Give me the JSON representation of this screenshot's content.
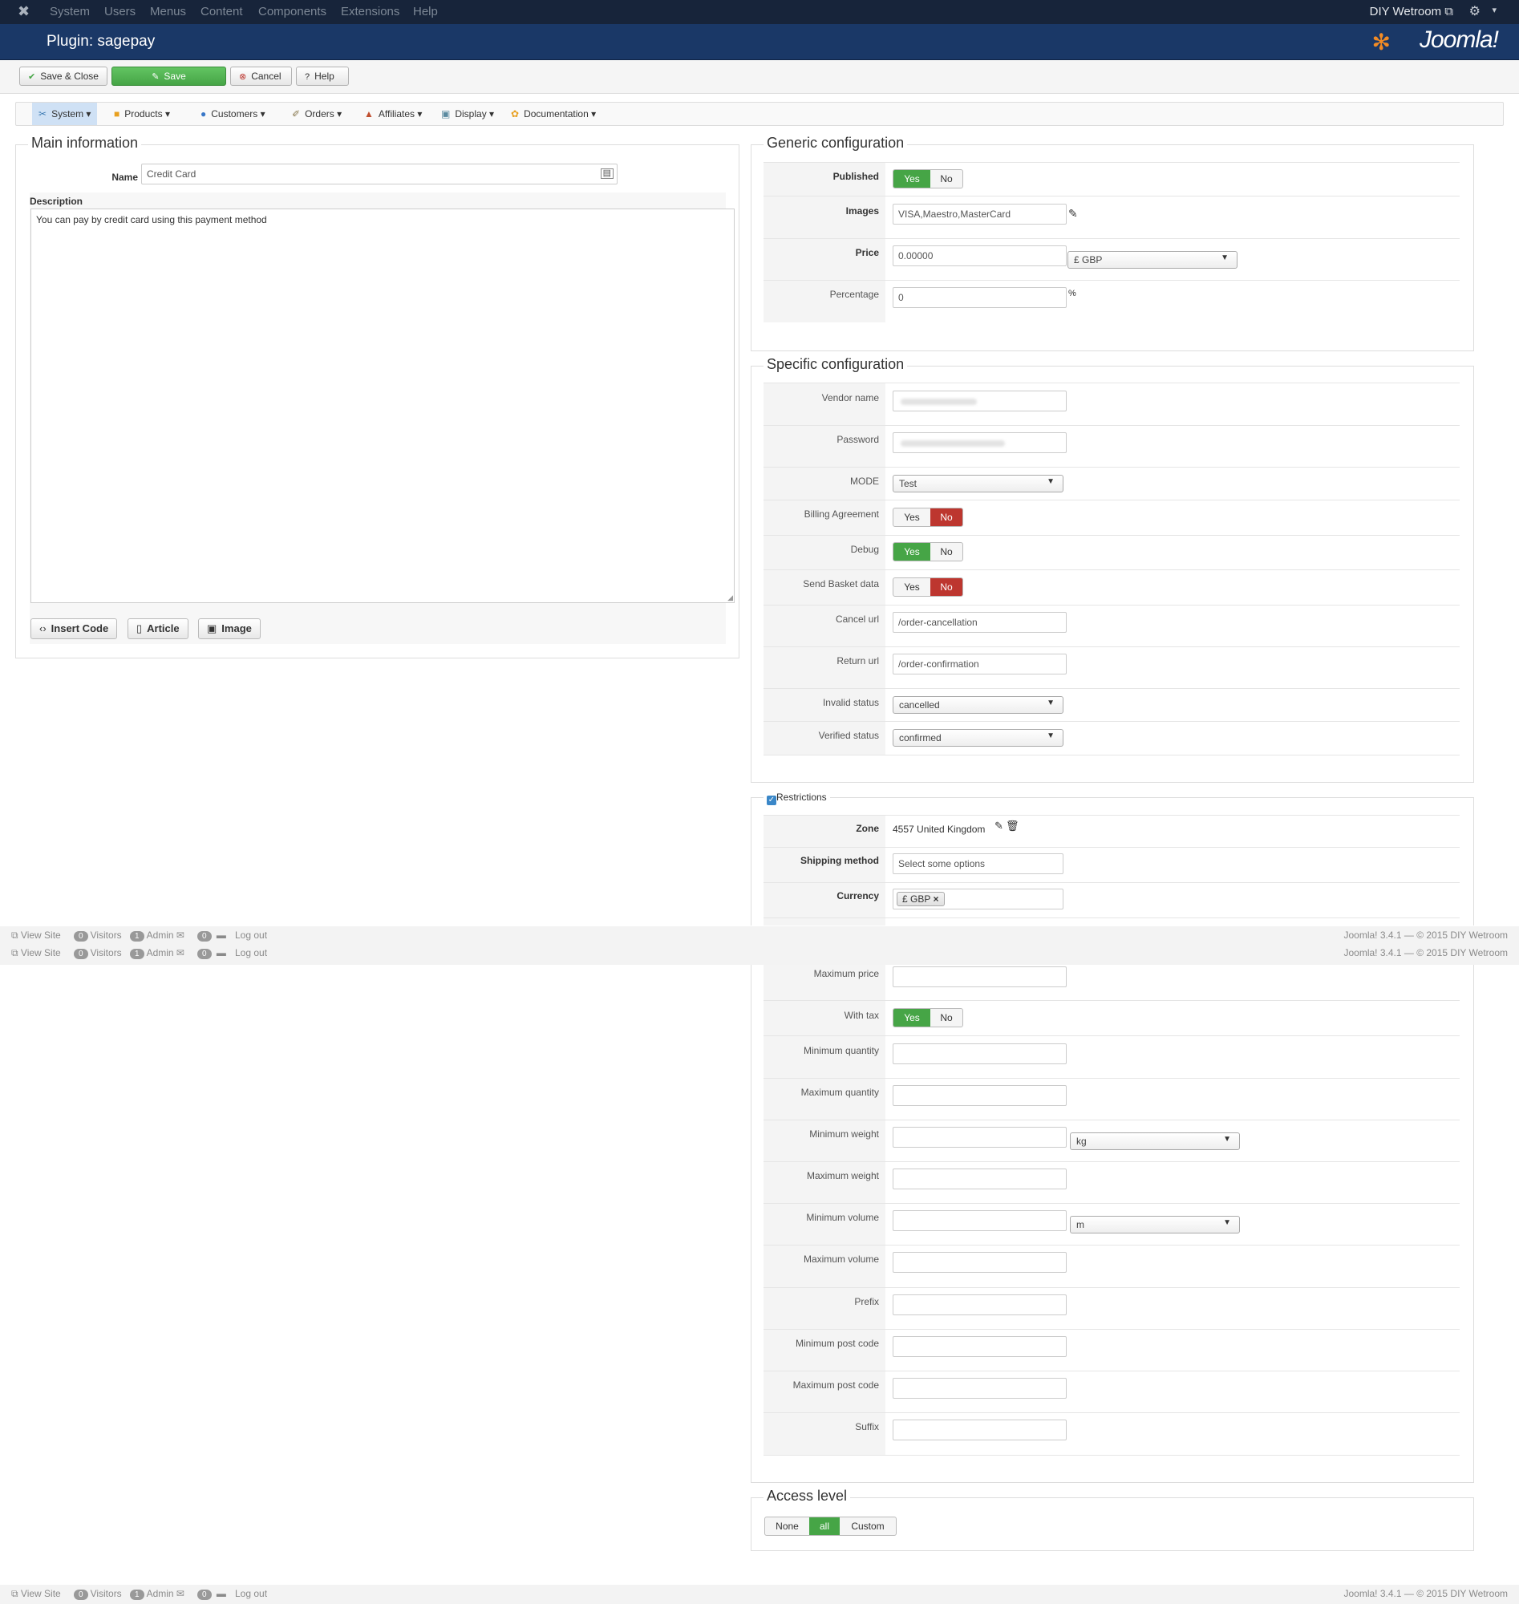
{
  "topbar": {
    "menu": [
      "System",
      "Users",
      "Menus",
      "Content",
      "Components",
      "Extensions",
      "Help"
    ],
    "site_name": "DIY Wetroom"
  },
  "header": {
    "title": "Plugin: sagepay",
    "brand": "Joomla!"
  },
  "toolbar": {
    "save_close": "Save & Close",
    "save": "Save",
    "cancel": "Cancel",
    "help": "Help"
  },
  "nav": [
    "System",
    "Products",
    "Customers",
    "Orders",
    "Affiliates",
    "Display",
    "Documentation"
  ],
  "main": {
    "legend": "Main information",
    "name_label": "Name",
    "name_value": "Credit Card",
    "desc_label": "Description",
    "desc_value": "You can pay by credit card using this payment method",
    "btn_insert": "Insert Code",
    "btn_article": "Article",
    "btn_image": "Image"
  },
  "generic": {
    "legend": "Generic configuration",
    "published": "Published",
    "images": "Images",
    "images_value": "VISA,Maestro,MasterCard",
    "price": "Price",
    "price_value": "0.00000",
    "currency": "£ GBP",
    "percentage": "Percentage",
    "percentage_value": "0",
    "percent_sign": "%",
    "yes": "Yes",
    "no": "No"
  },
  "specific": {
    "legend": "Specific configuration",
    "vendor": "Vendor name",
    "password": "Password",
    "mode": "MODE",
    "mode_value": "Test",
    "billing": "Billing Agreement",
    "debug": "Debug",
    "basket": "Send Basket data",
    "cancel_url": "Cancel url",
    "cancel_url_value": "/order-cancellation",
    "return_url": "Return url",
    "return_url_value": "/order-confirmation",
    "invalid": "Invalid status",
    "invalid_value": "cancelled",
    "verified": "Verified status",
    "verified_value": "confirmed"
  },
  "restrictions": {
    "legend": "Restrictions",
    "zone": "Zone",
    "zone_value": "4557 United Kingdom",
    "shipping": "Shipping method",
    "shipping_placeholder": "Select some options",
    "currency": "Currency",
    "currency_chip": "£ GBP",
    "max_price": "Maximum price",
    "with_tax": "With tax",
    "min_qty": "Minimum quantity",
    "max_qty": "Maximum quantity",
    "min_weight": "Minimum weight",
    "weight_unit": "kg",
    "max_weight": "Maximum weight",
    "min_volume": "Minimum volume",
    "volume_unit": "m",
    "max_volume": "Maximum volume",
    "prefix": "Prefix",
    "min_post": "Minimum post code",
    "max_post": "Maximum post code",
    "suffix": "Suffix"
  },
  "access": {
    "legend": "Access level",
    "none": "None",
    "all": "all",
    "custom": "Custom"
  },
  "status": {
    "view_site": "View Site",
    "visitors_count": "0",
    "visitors": "Visitors",
    "admin_count": "1",
    "admin": "Admin",
    "msg_count": "0",
    "logout": "Log out",
    "version": "Joomla! 3.4.1",
    "dash": "—",
    "copyright": "© 2015 DIY Wetroom"
  },
  "colors": {
    "header": "#1a3867",
    "topbar": "#17243a",
    "green": "#46a546",
    "red": "#bd362f"
  }
}
